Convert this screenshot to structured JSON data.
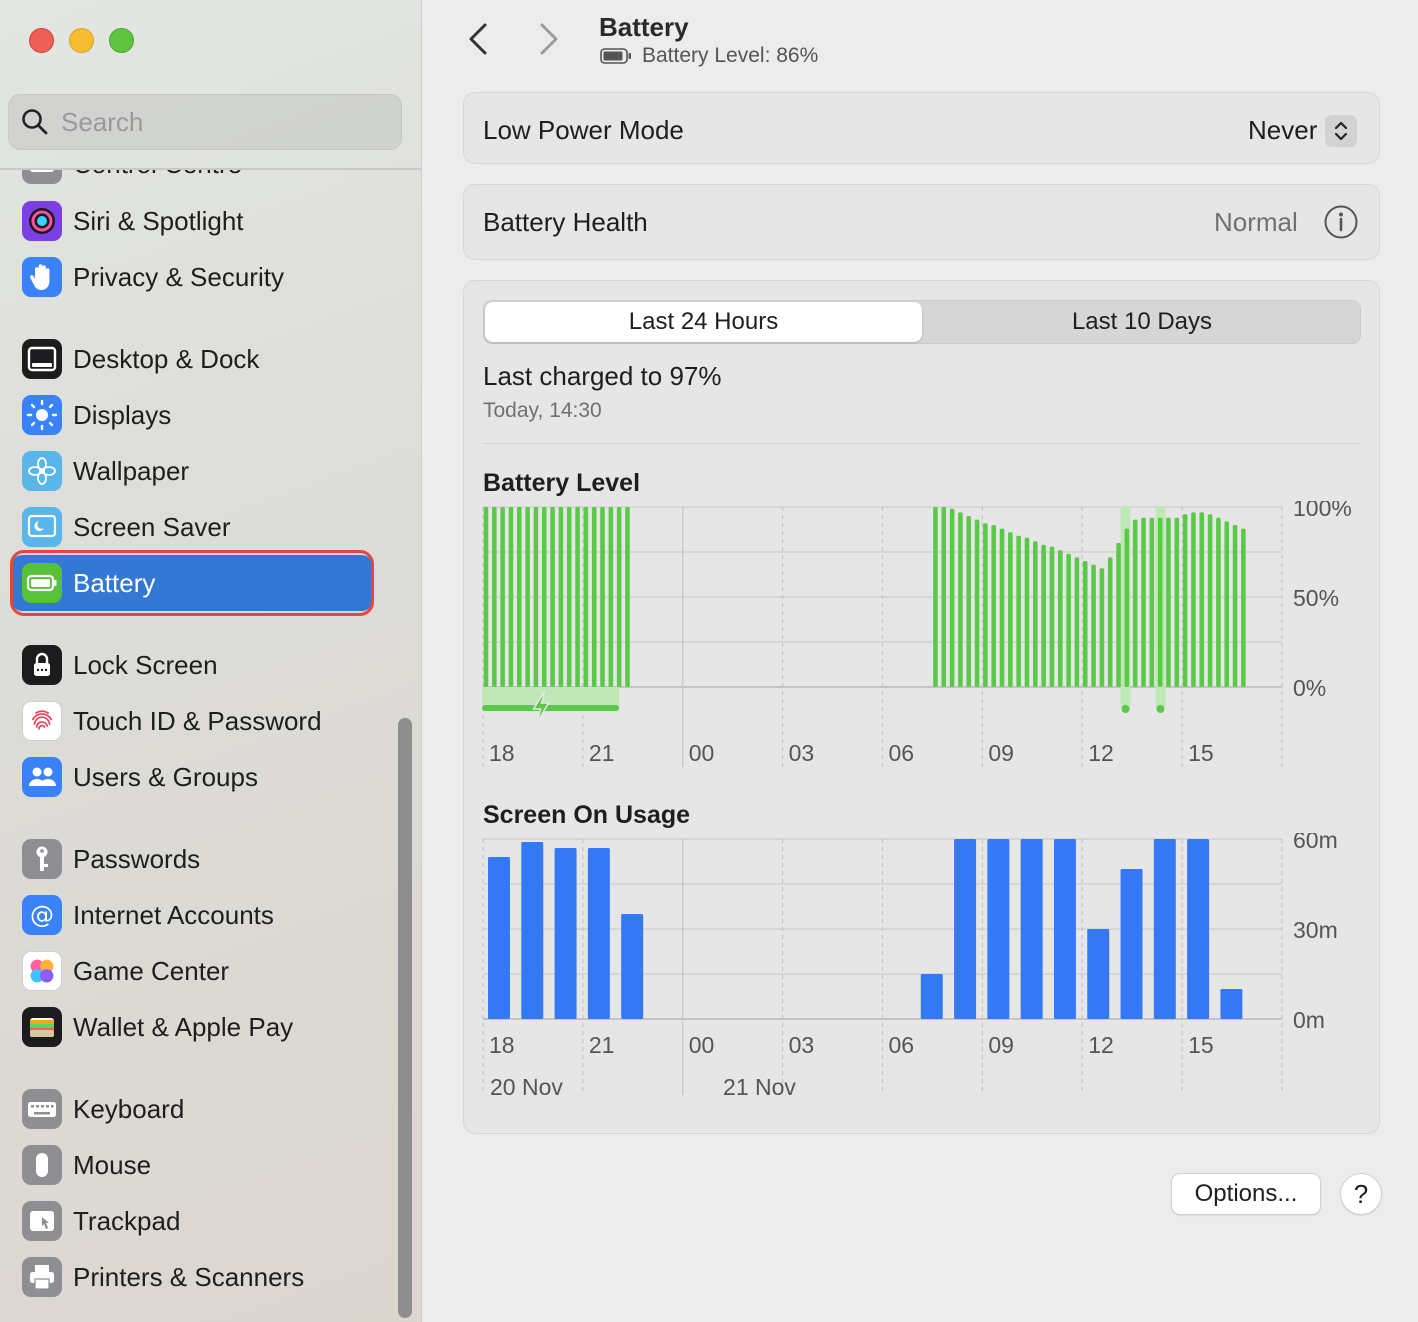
{
  "window": {
    "title": "Battery",
    "subtitle": "Battery Level: 86%"
  },
  "search": {
    "placeholder": "Search",
    "value": ""
  },
  "sidebar": {
    "items": [
      {
        "label": "Control Centre",
        "icon": "control-centre-icon",
        "color": "#8e8e93"
      },
      {
        "label": "Siri & Spotlight",
        "icon": "siri-icon",
        "color": "#7b3fe4"
      },
      {
        "label": "Privacy & Security",
        "icon": "hand-icon",
        "color": "#3a82f7"
      },
      {
        "label": "Desktop & Dock",
        "icon": "dock-icon",
        "color": "#1c1c1e"
      },
      {
        "label": "Displays",
        "icon": "sun-icon",
        "color": "#3a82f7"
      },
      {
        "label": "Wallpaper",
        "icon": "flower-icon",
        "color": "#5ab5e8"
      },
      {
        "label": "Screen Saver",
        "icon": "screen-saver-icon",
        "color": "#5ab5e8"
      },
      {
        "label": "Battery",
        "icon": "battery-icon",
        "color": "#58c13a",
        "active": true
      },
      {
        "label": "Lock Screen",
        "icon": "lock-icon",
        "color": "#1c1c1e"
      },
      {
        "label": "Touch ID & Password",
        "icon": "fingerprint-icon",
        "color": "#ffffff"
      },
      {
        "label": "Users & Groups",
        "icon": "users-icon",
        "color": "#3a82f7"
      },
      {
        "label": "Passwords",
        "icon": "key-icon",
        "color": "#8e8e93"
      },
      {
        "label": "Internet Accounts",
        "icon": "at-icon",
        "color": "#3a82f7"
      },
      {
        "label": "Game Center",
        "icon": "game-center-icon",
        "color": "#ffffff"
      },
      {
        "label": "Wallet & Apple Pay",
        "icon": "wallet-icon",
        "color": "#1c1c1e"
      },
      {
        "label": "Keyboard",
        "icon": "keyboard-icon",
        "color": "#8e8e93"
      },
      {
        "label": "Mouse",
        "icon": "mouse-icon",
        "color": "#8e8e93"
      },
      {
        "label": "Trackpad",
        "icon": "trackpad-icon",
        "color": "#8e8e93"
      },
      {
        "label": "Printers & Scanners",
        "icon": "printer-icon",
        "color": "#8e8e93"
      }
    ]
  },
  "low_power": {
    "label": "Low Power Mode",
    "value": "Never"
  },
  "health": {
    "label": "Battery Health",
    "value": "Normal"
  },
  "tabs": [
    {
      "label": "Last 24 Hours",
      "selected": true
    },
    {
      "label": "Last 10 Days",
      "selected": false
    }
  ],
  "last_charged": {
    "text": "Last charged to 97%",
    "time": "Today, 14:30"
  },
  "buttons": {
    "options": "Options...",
    "help": "?"
  },
  "colors": {
    "battery_green": "#5cc84a",
    "usage_blue": "#3478f6",
    "charging_green": "#5cc84a",
    "accent": "#3478d4"
  },
  "chart_data": [
    {
      "type": "bar",
      "title": "Battery Level",
      "x_ticks": [
        "18",
        "21",
        "00",
        "03",
        "06",
        "09",
        "12",
        "15"
      ],
      "y_ticks": [
        "100%",
        "50%",
        "0%"
      ],
      "ylim": [
        0,
        100
      ],
      "x_unit": "hours from 17:00 on 20 Nov",
      "levels": [
        {
          "x": 0.0,
          "y": 100
        },
        {
          "x": 0.25,
          "y": 100
        },
        {
          "x": 0.5,
          "y": 100
        },
        {
          "x": 0.75,
          "y": 100
        },
        {
          "x": 1.0,
          "y": 100
        },
        {
          "x": 1.25,
          "y": 100
        },
        {
          "x": 1.5,
          "y": 100
        },
        {
          "x": 1.75,
          "y": 100
        },
        {
          "x": 2.0,
          "y": 100
        },
        {
          "x": 2.25,
          "y": 100
        },
        {
          "x": 2.5,
          "y": 100
        },
        {
          "x": 2.75,
          "y": 100
        },
        {
          "x": 3.0,
          "y": 100
        },
        {
          "x": 3.25,
          "y": 100
        },
        {
          "x": 3.5,
          "y": 100
        },
        {
          "x": 3.75,
          "y": 100
        },
        {
          "x": 4.0,
          "y": 100
        },
        {
          "x": 4.25,
          "y": 100
        },
        {
          "x": 13.5,
          "y": 100
        },
        {
          "x": 13.75,
          "y": 100
        },
        {
          "x": 14.0,
          "y": 99
        },
        {
          "x": 14.25,
          "y": 97
        },
        {
          "x": 14.5,
          "y": 95
        },
        {
          "x": 14.75,
          "y": 93
        },
        {
          "x": 15.0,
          "y": 91
        },
        {
          "x": 15.25,
          "y": 90
        },
        {
          "x": 15.5,
          "y": 88
        },
        {
          "x": 15.75,
          "y": 86
        },
        {
          "x": 16.0,
          "y": 84
        },
        {
          "x": 16.25,
          "y": 83
        },
        {
          "x": 16.5,
          "y": 81
        },
        {
          "x": 16.75,
          "y": 79
        },
        {
          "x": 17.0,
          "y": 78
        },
        {
          "x": 17.25,
          "y": 76
        },
        {
          "x": 17.5,
          "y": 74
        },
        {
          "x": 17.75,
          "y": 72
        },
        {
          "x": 18.0,
          "y": 70
        },
        {
          "x": 18.25,
          "y": 68
        },
        {
          "x": 18.5,
          "y": 66
        },
        {
          "x": 18.75,
          "y": 72
        },
        {
          "x": 19.0,
          "y": 80
        },
        {
          "x": 19.25,
          "y": 88
        },
        {
          "x": 19.5,
          "y": 93
        },
        {
          "x": 19.75,
          "y": 94
        },
        {
          "x": 20.0,
          "y": 94
        },
        {
          "x": 20.25,
          "y": 94
        },
        {
          "x": 20.5,
          "y": 94
        },
        {
          "x": 20.75,
          "y": 94
        },
        {
          "x": 21.0,
          "y": 96
        },
        {
          "x": 21.25,
          "y": 97
        },
        {
          "x": 21.5,
          "y": 97
        },
        {
          "x": 21.75,
          "y": 96
        },
        {
          "x": 22.0,
          "y": 94
        },
        {
          "x": 22.25,
          "y": 92
        },
        {
          "x": 22.5,
          "y": 90
        },
        {
          "x": 22.75,
          "y": 88
        }
      ],
      "charging_periods": [
        {
          "from": 0,
          "to": 4.3
        }
      ],
      "charging_markers": [
        19.3,
        20.35
      ]
    },
    {
      "type": "bar",
      "title": "Screen On Usage",
      "x_ticks": [
        "18",
        "21",
        "00",
        "03",
        "06",
        "09",
        "12",
        "15"
      ],
      "y_ticks": [
        "60m",
        "30m",
        "0m"
      ],
      "date_labels": [
        "20 Nov",
        "21 Nov"
      ],
      "ylim": [
        0,
        60
      ],
      "x_unit": "hours from 17:00 on 20 Nov",
      "bars": [
        {
          "hour": 0,
          "minutes": 54
        },
        {
          "hour": 1,
          "minutes": 59
        },
        {
          "hour": 2,
          "minutes": 57
        },
        {
          "hour": 3,
          "minutes": 57
        },
        {
          "hour": 4,
          "minutes": 35
        },
        {
          "hour": 13,
          "minutes": 15
        },
        {
          "hour": 14,
          "minutes": 60
        },
        {
          "hour": 15,
          "minutes": 60
        },
        {
          "hour": 16,
          "minutes": 60
        },
        {
          "hour": 17,
          "minutes": 60
        },
        {
          "hour": 18,
          "minutes": 30
        },
        {
          "hour": 19,
          "minutes": 50
        },
        {
          "hour": 20,
          "minutes": 60
        },
        {
          "hour": 21,
          "minutes": 60
        },
        {
          "hour": 22,
          "minutes": 10
        }
      ]
    }
  ]
}
